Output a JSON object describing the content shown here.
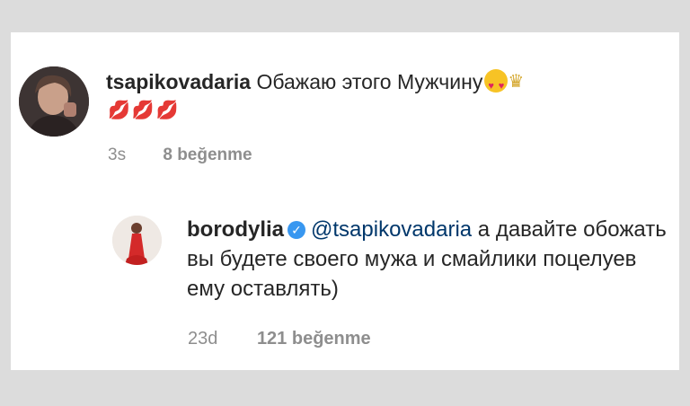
{
  "comment1": {
    "username": "tsapikovadaria",
    "text": "Обажаю этого Мужчину",
    "emoji_face": "heart-eyes-face-icon",
    "emoji_crown": "crown-icon",
    "kisses": "💋💋💋",
    "time": "3s",
    "likes": "8 beğenme"
  },
  "comment2": {
    "username": "borodylia",
    "verified_icon": "verified-badge-icon",
    "mention": "@tsapikovadaria",
    "text": " а давайте обожать вы будете своего мужа и смайлики поцелуев ему оставлять)",
    "time": "23d",
    "likes": "121 beğenme"
  },
  "colors": {
    "background": "#dcdcdc",
    "card": "#ffffff",
    "text": "#262626",
    "meta": "#8e8e8e",
    "mention": "#00376b",
    "verified": "#3897f0"
  }
}
